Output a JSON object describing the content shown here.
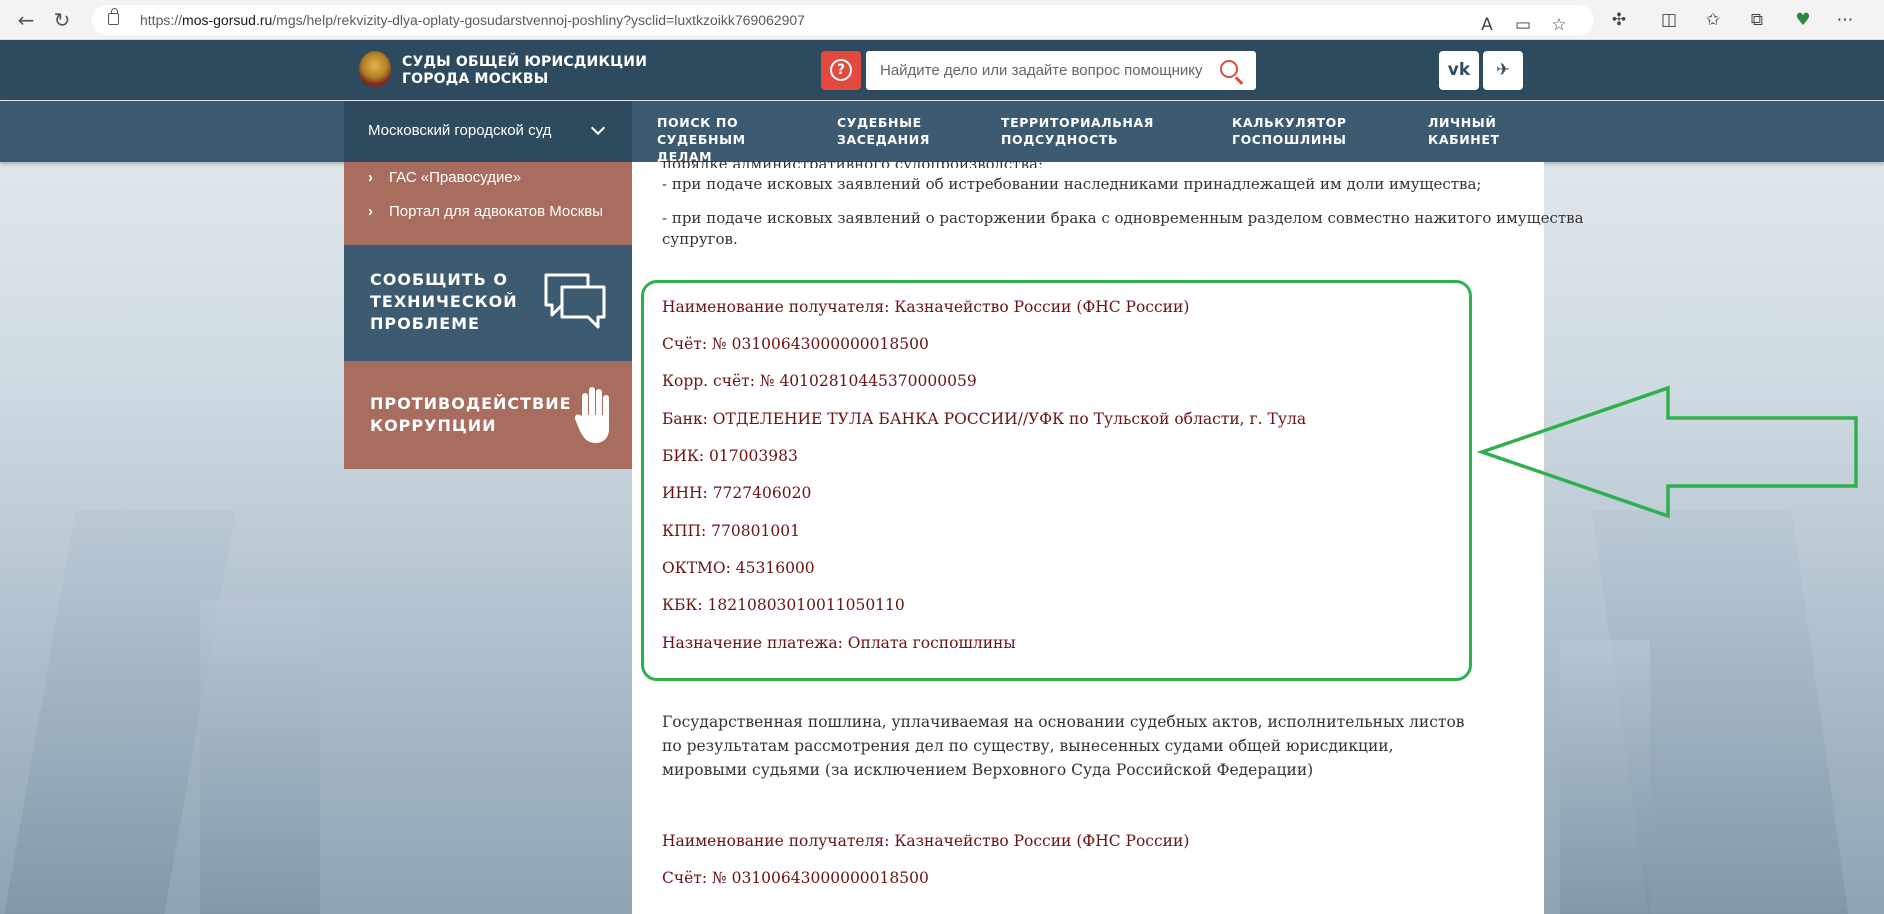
{
  "browser": {
    "url_prefix": "https://",
    "url_domain": "mos-gorsud.ru",
    "url_path": "/mgs/help/rekvizity-dlya-oplaty-gosudarstvennoj-poshliny?ysclid=luxtkzoikk769062907"
  },
  "header": {
    "logo_line1": "СУДЫ ОБЩЕЙ ЮРИСДИКЦИИ",
    "logo_line2": "ГОРОДА МОСКВЫ",
    "search_placeholder": "Найдите дело или задайте вопрос помощнику",
    "help_label": "?",
    "vk_label": "vk",
    "telegram_label": "✈"
  },
  "nav": {
    "court_select": "Московский городской суд",
    "items": [
      "ПОИСК ПО\nСУДЕБНЫМ\nДЕЛАМ",
      "СУДЕБНЫЕ\nЗАСЕДАНИЯ",
      "ТЕРРИТОРИАЛЬНАЯ\nПОДСУДНОСТЬ",
      "КАЛЬКУЛЯТОР\nГОСПОШЛИНЫ",
      "ЛИЧНЫЙ\nКАБИНЕТ"
    ]
  },
  "sidebar": {
    "links": [
      "ГАС «Правосудие»",
      "Портал для адвокатов Москвы"
    ],
    "report_line1": "СООБЩИТЬ О",
    "report_line2": "ТЕХНИЧЕСКОЙ",
    "report_line3": "ПРОБЛЕМЕ",
    "anti_line1": "ПРОТИВОДЕЙСТВИЕ",
    "anti_line2": "КОРРУПЦИИ"
  },
  "content": {
    "partial_top": "порядке административного судопроизводства;",
    "para1": "- при подаче исковых заявлений об истребовании наследниками принадлежащей им доли имущества;",
    "para2_line1": "- при подаче исковых заявлений о расторжении брака с одновременным разделом совместно нажитого имущества",
    "para2_line2": "супругов.",
    "requisites": [
      "Наименование получателя: Казначейство России (ФНС России)",
      "Счёт: № 03100643000000018500",
      "Корр. счёт: № 40102810445370000059",
      "Банк: ОТДЕЛЕНИЕ ТУЛА БАНКА РОССИИ//УФК по Тульской области, г. Тула",
      "БИК: 017003983",
      "ИНН: 7727406020",
      "КПП: 770801001",
      "ОКТМО: 45316000",
      "КБК: 18210803010011050110",
      "Назначение платежа: Оплата госпошлины"
    ],
    "para3_line1": "Государственная пошлина, уплачиваемая на основании судебных актов, исполнительных листов",
    "para3_line2": "по результатам рассмотрения дел по существу, вынесенных судами общей юрисдикции,",
    "para3_line3": "мировыми судьями (за исключением Верховного Суда Российской Федерации)",
    "requisites2": [
      "Наименование получателя: Казначейство России (ФНС России)",
      "Счёт: № 03100643000000018500"
    ]
  },
  "colors": {
    "header_bg": "#2e4a5e",
    "sidebar_brown": "#a86d5f",
    "requisite_text": "#6b1212",
    "highlight_green": "#30b04c"
  }
}
